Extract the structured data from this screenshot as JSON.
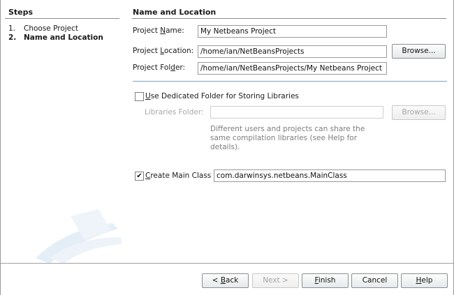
{
  "steps": {
    "title": "Steps",
    "items": [
      {
        "num": "1.",
        "label": "Choose Project"
      },
      {
        "num": "2.",
        "label": "Name and Location"
      }
    ]
  },
  "section": {
    "title": "Name and Location",
    "project_name": {
      "label_pre": "Project ",
      "label_key": "N",
      "label_post": "ame:",
      "value": "My Netbeans Project"
    },
    "project_location": {
      "label_pre": "Project ",
      "label_key": "L",
      "label_post": "ocation:",
      "value": "/home/ian/NetBeansProjects",
      "browse": "Browse..."
    },
    "project_folder": {
      "label_pre": "Project Fol",
      "label_key": "d",
      "label_post": "er:",
      "value": "/home/ian/NetBeansProjects/My Netbeans Project"
    },
    "dedicated_folder": {
      "key": "U",
      "label_post": "se Dedicated Folder for Storing Libraries",
      "checked": false
    },
    "libraries_folder": {
      "label": "Libraries Folder:",
      "value": "",
      "browse": "Browse..."
    },
    "help_text": "Different users and projects can share the same compilation libraries (see Help for details).",
    "main_class": {
      "check_mark": "✔",
      "key": "C",
      "label_post": "reate Main Class",
      "checked": true,
      "value": "com.darwinsys.netbeans.MainClass"
    }
  },
  "buttons": {
    "back": {
      "pre": "< ",
      "key": "B",
      "post": "ack"
    },
    "next": "Next >",
    "finish": {
      "key": "F",
      "post": "inish"
    },
    "cancel": "Cancel",
    "help": {
      "key": "H",
      "post": "elp"
    }
  },
  "colors": {
    "divider": "#7da2c8",
    "disabled_text": "#a8a8a8"
  }
}
